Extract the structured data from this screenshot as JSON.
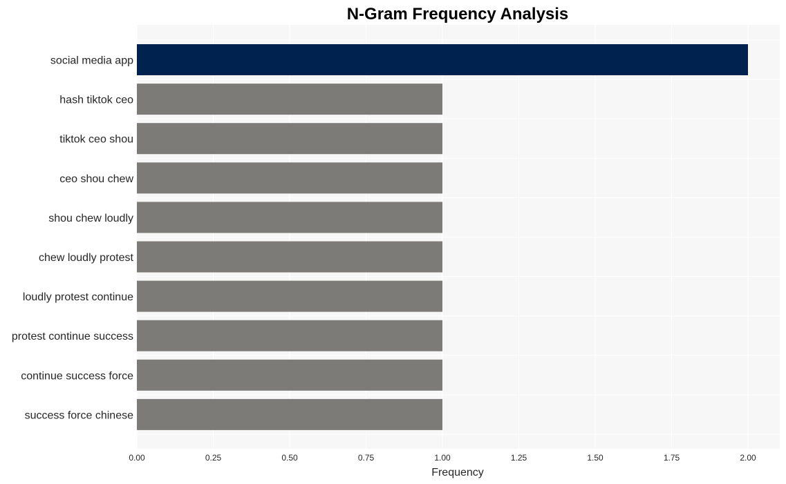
{
  "chart_data": {
    "type": "bar",
    "orientation": "horizontal",
    "title": "N-Gram Frequency Analysis",
    "xlabel": "Frequency",
    "ylabel": "",
    "xlim": [
      0,
      2.1
    ],
    "xticks": [
      0.0,
      0.25,
      0.5,
      0.75,
      1.0,
      1.25,
      1.5,
      1.75,
      2.0
    ],
    "xtick_labels": [
      "0.00",
      "0.25",
      "0.50",
      "0.75",
      "1.00",
      "1.25",
      "1.50",
      "1.75",
      "2.00"
    ],
    "grid": true,
    "categories": [
      "social media app",
      "hash tiktok ceo",
      "tiktok ceo shou",
      "ceo shou chew",
      "shou chew loudly",
      "chew loudly protest",
      "loudly protest continue",
      "protest continue success",
      "continue success force",
      "success force chinese"
    ],
    "values": [
      2,
      1,
      1,
      1,
      1,
      1,
      1,
      1,
      1,
      1
    ],
    "colors": {
      "highlight": "#00224e",
      "default": "#7c7b78",
      "plot_background": "#f7f7f7",
      "grid": "#ffffff"
    }
  }
}
